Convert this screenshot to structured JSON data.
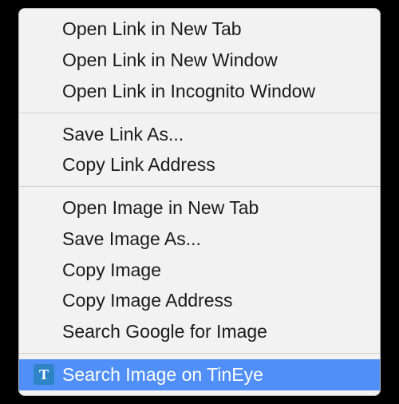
{
  "menu": {
    "groups": [
      [
        {
          "id": "open-link-new-tab",
          "label": "Open Link in New Tab"
        },
        {
          "id": "open-link-new-window",
          "label": "Open Link in New Window"
        },
        {
          "id": "open-link-incognito",
          "label": "Open Link in Incognito Window"
        }
      ],
      [
        {
          "id": "save-link-as",
          "label": "Save Link As..."
        },
        {
          "id": "copy-link-address",
          "label": "Copy Link Address"
        }
      ],
      [
        {
          "id": "open-image-new-tab",
          "label": "Open Image in New Tab"
        },
        {
          "id": "save-image-as",
          "label": "Save Image As..."
        },
        {
          "id": "copy-image",
          "label": "Copy Image"
        },
        {
          "id": "copy-image-address",
          "label": "Copy Image Address"
        },
        {
          "id": "search-google-image",
          "label": "Search Google for Image"
        }
      ],
      [
        {
          "id": "search-tineye",
          "label": "Search Image on TinEye",
          "icon": "tineye",
          "iconLetter": "T",
          "selected": true
        }
      ]
    ]
  }
}
